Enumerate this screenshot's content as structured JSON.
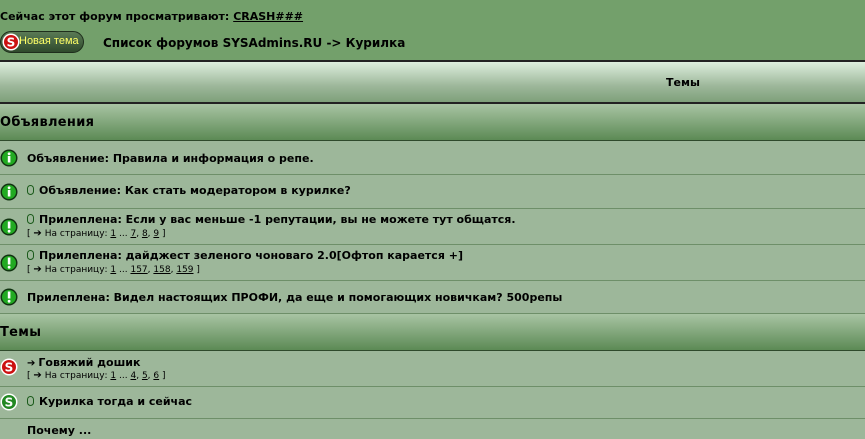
{
  "header": {
    "viewing_prefix": "Сейчас этот форум просматривают:",
    "viewing_user": "CRASH###",
    "new_topic_label": "Новая тема",
    "breadcrumb": "Список форумов SYSAdmins.RU -> Курилка"
  },
  "table": {
    "col_topics": "Темы",
    "sections": [
      {
        "title": "Объявления",
        "rows": [
          {
            "icon": "info-icon",
            "clip": false,
            "text": "Объявление: Правила и информация о репе.",
            "pages": null
          },
          {
            "icon": "info-icon",
            "clip": true,
            "text": "Объявление: Как стать модератором в курилке?",
            "pages": null
          },
          {
            "icon": "sticky-icon",
            "clip": true,
            "text": "Прилеплена: Если у вас меньше -1 репутации, вы не можете тут общатся.",
            "pages": {
              "prefix": "[ ",
              "label": "На страницу:",
              "links": [
                "1",
                "7",
                "8",
                "9"
              ],
              "suffix": " ]"
            }
          },
          {
            "icon": "sticky-icon",
            "clip": true,
            "text": "Прилеплена: дайджест зеленого чоноваго 2.0[Офтоп карается +]",
            "pages": {
              "prefix": "[ ",
              "label": "На страницу:",
              "links": [
                "1",
                "157",
                "158",
                "159"
              ],
              "suffix": " ]"
            }
          },
          {
            "icon": "sticky-icon",
            "clip": false,
            "text": "Прилеплена: Видел настоящих ПРОФИ, да еще и помогающих новичкам? 500репы",
            "pages": null
          }
        ]
      },
      {
        "title": "Темы",
        "rows": [
          {
            "icon": "hot-topic-icon",
            "clip": false,
            "newpost": true,
            "text": "Говяжий дошик",
            "pages": {
              "prefix": "[ ",
              "label": "На страницу:",
              "links": [
                "1",
                "4",
                "5",
                "6"
              ],
              "suffix": " ]"
            }
          },
          {
            "icon": "topic-icon",
            "clip": true,
            "text": "Курилка тогда и сейчас",
            "pages": null
          }
        ]
      }
    ],
    "partial_row_text": "Почему ..."
  }
}
